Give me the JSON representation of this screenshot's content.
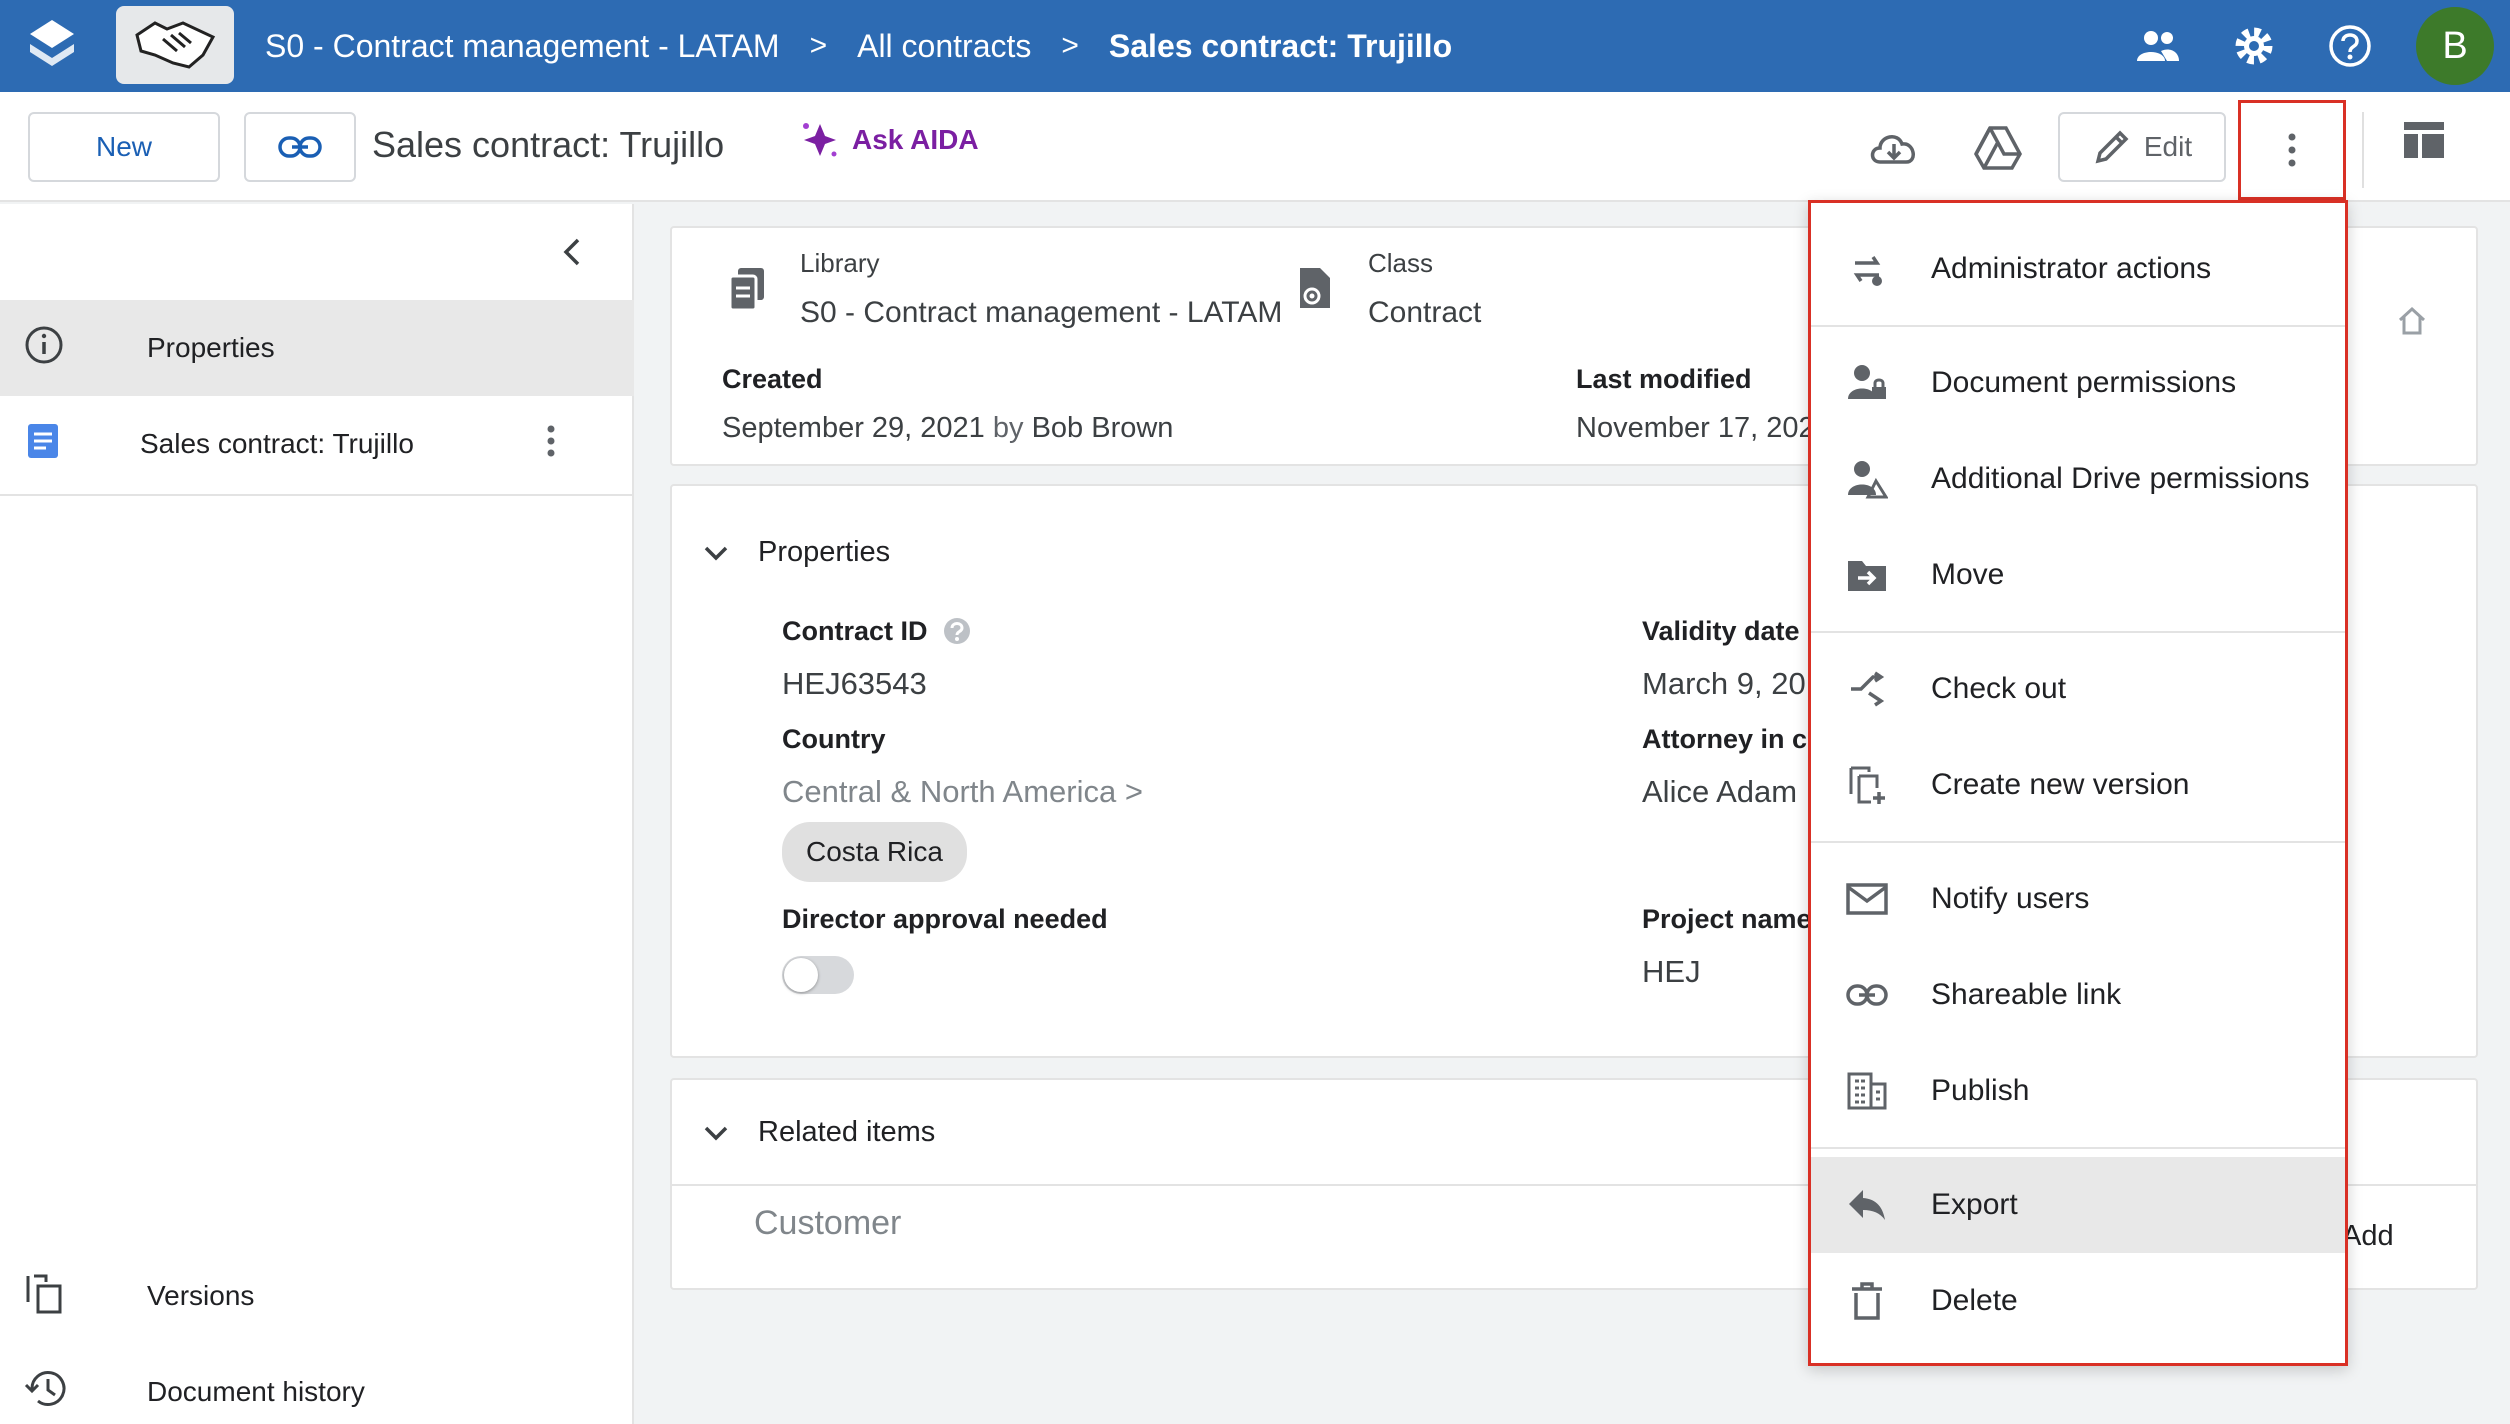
{
  "breadcrumb": {
    "items": [
      "S0 - Contract management - LATAM",
      "All contracts",
      "Sales contract: Trujillo"
    ]
  },
  "header": {
    "avatar_initial": "B"
  },
  "toolbar": {
    "new_label": "New",
    "doc_title": "Sales contract: Trujillo",
    "ask_aida_label": "Ask AIDA",
    "edit_label": "Edit"
  },
  "sidebar": {
    "properties_label": "Properties",
    "document_label": "Sales contract: Trujillo",
    "versions_label": "Versions",
    "history_label": "Document history"
  },
  "summary": {
    "library_label": "Library",
    "library_value": "S0 - Contract management - LATAM",
    "class_label": "Class",
    "class_value": "Contract",
    "created_label": "Created",
    "created_date": "September 29, 2021",
    "created_by_word": "by",
    "created_by": "Bob Brown",
    "modified_label": "Last modified",
    "modified_date": "November 17, 202"
  },
  "properties": {
    "section_title": "Properties",
    "contract_id_label": "Contract ID",
    "contract_id_value": "HEJ63543",
    "country_label": "Country",
    "country_path": "Central & North America >",
    "country_chip": "Costa Rica",
    "director_label": "Director approval needed",
    "validity_label": "Validity date",
    "validity_value": "March 9, 20",
    "attorney_label": "Attorney in ch",
    "attorney_value": "Alice Adam",
    "project_label": "Project name",
    "project_value": "HEJ"
  },
  "related": {
    "section_title": "Related items",
    "customer_label": "Customer",
    "add_label": "Add"
  },
  "menu": {
    "items": [
      "Administrator actions",
      "Document permissions",
      "Additional Drive permissions",
      "Move",
      "Check out",
      "Create new version",
      "Notify users",
      "Shareable link",
      "Publish",
      "Export",
      "Delete"
    ]
  },
  "colors": {
    "brand": "#2d6bb3",
    "accent": "#1a5fb4",
    "aida": "#7b1fa2",
    "highlight": "#d93025"
  }
}
